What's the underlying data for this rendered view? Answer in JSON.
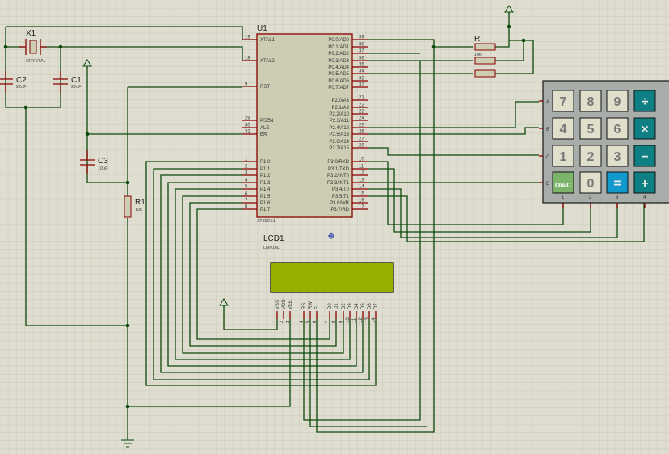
{
  "u1": {
    "ref": "U1",
    "part": "AT89C51",
    "left_pins": [
      [
        "19",
        "XTAL1"
      ],
      [
        "18",
        "XTAL2"
      ],
      [
        "9",
        "RST"
      ],
      [
        "29",
        "PSEN"
      ],
      [
        "30",
        "ALE"
      ],
      [
        "31",
        "EA"
      ],
      [
        "1",
        "P1.0"
      ],
      [
        "2",
        "P1.1"
      ],
      [
        "3",
        "P1.2"
      ],
      [
        "4",
        "P1.3"
      ],
      [
        "5",
        "P1.4"
      ],
      [
        "6",
        "P1.5"
      ],
      [
        "7",
        "P1.6"
      ],
      [
        "8",
        "P1.7"
      ]
    ],
    "right_pins": [
      [
        "39",
        "P0.0/AD0"
      ],
      [
        "38",
        "P0.1/AD1"
      ],
      [
        "37",
        "P0.2/AD2"
      ],
      [
        "36",
        "P0.3/AD3"
      ],
      [
        "35",
        "P0.4/AD4"
      ],
      [
        "34",
        "P0.5/AD5"
      ],
      [
        "33",
        "P0.6/AD6"
      ],
      [
        "32",
        "P0.7/AD7"
      ],
      [
        "21",
        "P2.0/A8"
      ],
      [
        "22",
        "P2.1/A9"
      ],
      [
        "23",
        "P2.2/A10"
      ],
      [
        "24",
        "P2.3/A11"
      ],
      [
        "25",
        "P2.4/A12"
      ],
      [
        "26",
        "P2.5/A13"
      ],
      [
        "27",
        "P2.6/A14"
      ],
      [
        "28",
        "P2.7/A15"
      ],
      [
        "10",
        "P3.0/RXD"
      ],
      [
        "11",
        "P3.1/TXD"
      ],
      [
        "12",
        "P3.2/INT0"
      ],
      [
        "13",
        "P3.3/INT1"
      ],
      [
        "14",
        "P3.4/T0"
      ],
      [
        "15",
        "P3.5/T1"
      ],
      [
        "16",
        "P3.6/WR"
      ],
      [
        "17",
        "P3.7/RD"
      ]
    ]
  },
  "x1": {
    "ref": "X1",
    "value": "CRYSTAL"
  },
  "c1": {
    "ref": "C1",
    "value": "22uF"
  },
  "c2": {
    "ref": "C2",
    "value": "22uF"
  },
  "c3": {
    "ref": "C3",
    "value": "10uF"
  },
  "r1": {
    "ref": "R1",
    "value": "10k"
  },
  "rpack": {
    "ref": "R",
    "value": "10k"
  },
  "lcd": {
    "ref": "LCD1",
    "part": "LM016L",
    "color": "#97b000",
    "pins": [
      [
        "1",
        "VSS"
      ],
      [
        "2",
        "VDD"
      ],
      [
        "3",
        "VEE"
      ],
      [
        "4",
        "RS"
      ],
      [
        "5",
        "RW"
      ],
      [
        "6",
        "E"
      ],
      [
        "7",
        "D0"
      ],
      [
        "8",
        "D1"
      ],
      [
        "9",
        "D2"
      ],
      [
        "10",
        "D3"
      ],
      [
        "11",
        "D4"
      ],
      [
        "12",
        "D5"
      ],
      [
        "13",
        "D6"
      ],
      [
        "14",
        "D7"
      ]
    ]
  },
  "keypad": {
    "rows": [
      "A",
      "B",
      "C",
      "D"
    ],
    "cols": [
      "1",
      "2",
      "3",
      "4"
    ],
    "keys": [
      [
        "7",
        "8",
        "9",
        "÷"
      ],
      [
        "4",
        "5",
        "6",
        "×"
      ],
      [
        "1",
        "2",
        "3",
        "−"
      ],
      [
        "ON/C",
        "0",
        "=",
        "+"
      ]
    ]
  }
}
